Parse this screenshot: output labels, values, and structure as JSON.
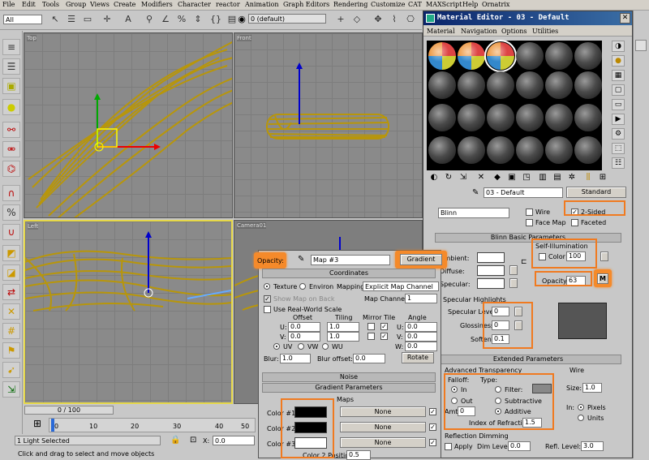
{
  "menu": [
    "File",
    "Edit",
    "Tools",
    "Group",
    "Views",
    "Create",
    "Modifiers",
    "Character",
    "reactor",
    "Animation",
    "Graph Editors",
    "Rendering",
    "Customize",
    "CAT",
    "MAXScript",
    "Help",
    "Ornatrix"
  ],
  "toolbar": {
    "selection_filter": "All",
    "layer": "0 (default)"
  },
  "viewports": {
    "top": "Top",
    "front": "Front",
    "left": "Left",
    "camera": "Camera01"
  },
  "time": {
    "slider": "0 / 100",
    "ticks": [
      "0",
      "10",
      "20",
      "30",
      "40",
      "50"
    ]
  },
  "status": {
    "selected": "1 Light Selected",
    "prompt": "Click and drag to select and move objects",
    "x_label": "X:",
    "x_value": "0.0"
  },
  "material_editor": {
    "title": "Material Editor - 03 - Default",
    "menu": [
      "Material",
      "Navigation",
      "Options",
      "Utilities"
    ],
    "material_name": "03 - Default",
    "material_type": "Standard",
    "shader": "Blinn",
    "wire": "Wire",
    "two_sided": "2-Sided",
    "face_map": "Face Map",
    "faceted": "Faceted",
    "blinn_header": "Blinn Basic Parameters",
    "self_illum": "Self-Illumination",
    "color_label": "Color",
    "self_illum_value": "100",
    "ambient": "Ambient:",
    "diffuse": "Diffuse:",
    "specular": "Specular:",
    "opacity_label": "Opacity:",
    "opacity_value": "63",
    "m_button": "M",
    "spec_highlights": "Specular Highlights",
    "spec_level": "Specular Level:",
    "spec_level_value": "0",
    "glossiness": "Glossiness:",
    "glossiness_value": "0",
    "soften": "Soften:",
    "soften_value": "0.1",
    "extended_header": "Extended Parameters",
    "adv_transparency": "Advanced Transparency",
    "falloff": "Falloff:",
    "type": "Type:",
    "in": "In",
    "out": "Out",
    "filter": "Filter:",
    "subtractive": "Subtractive",
    "additive": "Additive",
    "amt": "Amt:",
    "amt_value": "0",
    "ior": "Index of Refraction:",
    "ior_value": "1.5",
    "wire_group": "Wire",
    "size": "Size:",
    "size_value": "1.0",
    "in_label": "In:",
    "pixels": "Pixels",
    "units": "Units",
    "reflection_dimming": "Reflection Dimming",
    "apply": "Apply",
    "dim_level": "Dim Level:",
    "dim_level_value": "0.0",
    "refl_level": "Refl. Level:",
    "refl_level_value": "3.0"
  },
  "map_panel": {
    "opacity_label": "Opacity:",
    "map_name": "Map #3",
    "map_type": "Gradient",
    "coordinates": "Coordinates",
    "texture": "Texture",
    "environ": "Environ",
    "mapping": "Mapping:",
    "mapping_value": "Explicit Map Channel",
    "show_map_on_back": "Show Map on Back",
    "map_channel": "Map Channel:",
    "map_channel_value": "1",
    "real_world": "Use Real-World Scale",
    "offset": "Offset",
    "tiling": "Tiling",
    "mirror_tile": "Mirror Tile",
    "angle": "Angle",
    "u": "U:",
    "v": "V:",
    "w": "W:",
    "u_offset": "0.0",
    "v_offset": "0.0",
    "u_tiling": "1.0",
    "v_tiling": "1.0",
    "u_angle": "0.0",
    "v_angle": "0.0",
    "w_angle": "0.0",
    "uv": "UV",
    "vw": "VW",
    "wu": "WU",
    "blur": "Blur:",
    "blur_value": "1.0",
    "blur_offset": "Blur offset:",
    "blur_offset_value": "0.0",
    "rotate": "Rotate",
    "noise": "Noise",
    "gradient_params": "Gradient Parameters",
    "maps": "Maps",
    "color1": "Color #1",
    "color2": "Color #2",
    "color3": "Color #3",
    "none": "None",
    "color2_position": "Color 2 Position",
    "color2_position_value": "0.5",
    "colors": {
      "c1": "#000000",
      "c2": "#000000",
      "c3": "#ffffff"
    }
  },
  "colors": {
    "accent_highlight": "#f07a20",
    "object": "#b8960a",
    "active_border": "#e6d84a"
  }
}
